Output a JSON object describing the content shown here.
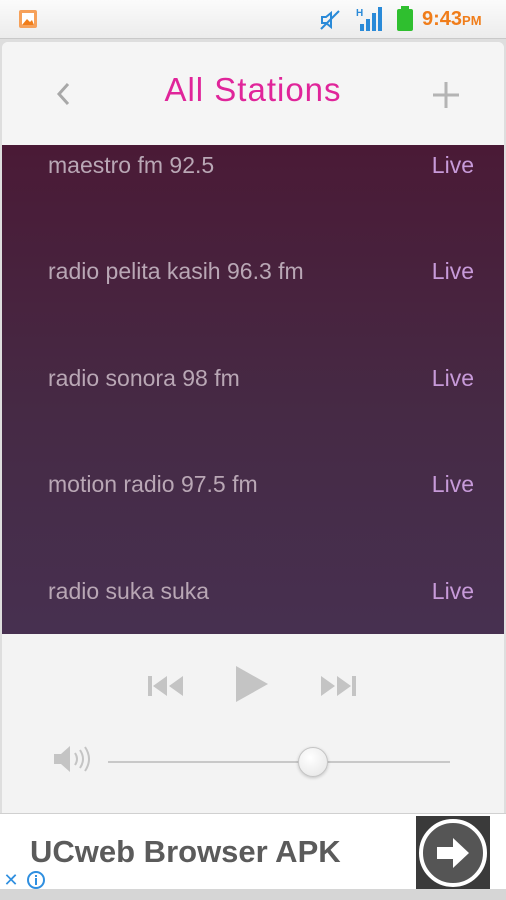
{
  "status_bar": {
    "time": "9:43",
    "ampm": "PM",
    "colors": {
      "clock": "#f07d1a",
      "battery": "#2fbf2f",
      "signal": "#2a8ad8"
    },
    "icons": [
      "gallery-icon",
      "mute-icon",
      "signal-icon",
      "battery-icon"
    ]
  },
  "header": {
    "title": "All Stations",
    "back_icon": "chevron-left-icon",
    "add_icon": "plus-icon",
    "accent": "#e0259a"
  },
  "stations": [
    {
      "name": "maestro fm 92.5",
      "status": "Live"
    },
    {
      "name": "radio pelita kasih 96.3 fm",
      "status": "Live"
    },
    {
      "name": "radio sonora 98 fm",
      "status": "Live"
    },
    {
      "name": "motion radio 97.5 fm",
      "status": "Live"
    },
    {
      "name": "radio suka suka",
      "status": "Live"
    }
  ],
  "player": {
    "controls": [
      "previous-icon",
      "play-icon",
      "next-icon"
    ],
    "volume_icon": "speaker-icon",
    "volume_level": 0.6
  },
  "ad": {
    "text": "UCweb Browser APK",
    "button_icon": "arrow-right-icon",
    "close_glyph": "✕",
    "info_icon": "info-icon"
  }
}
